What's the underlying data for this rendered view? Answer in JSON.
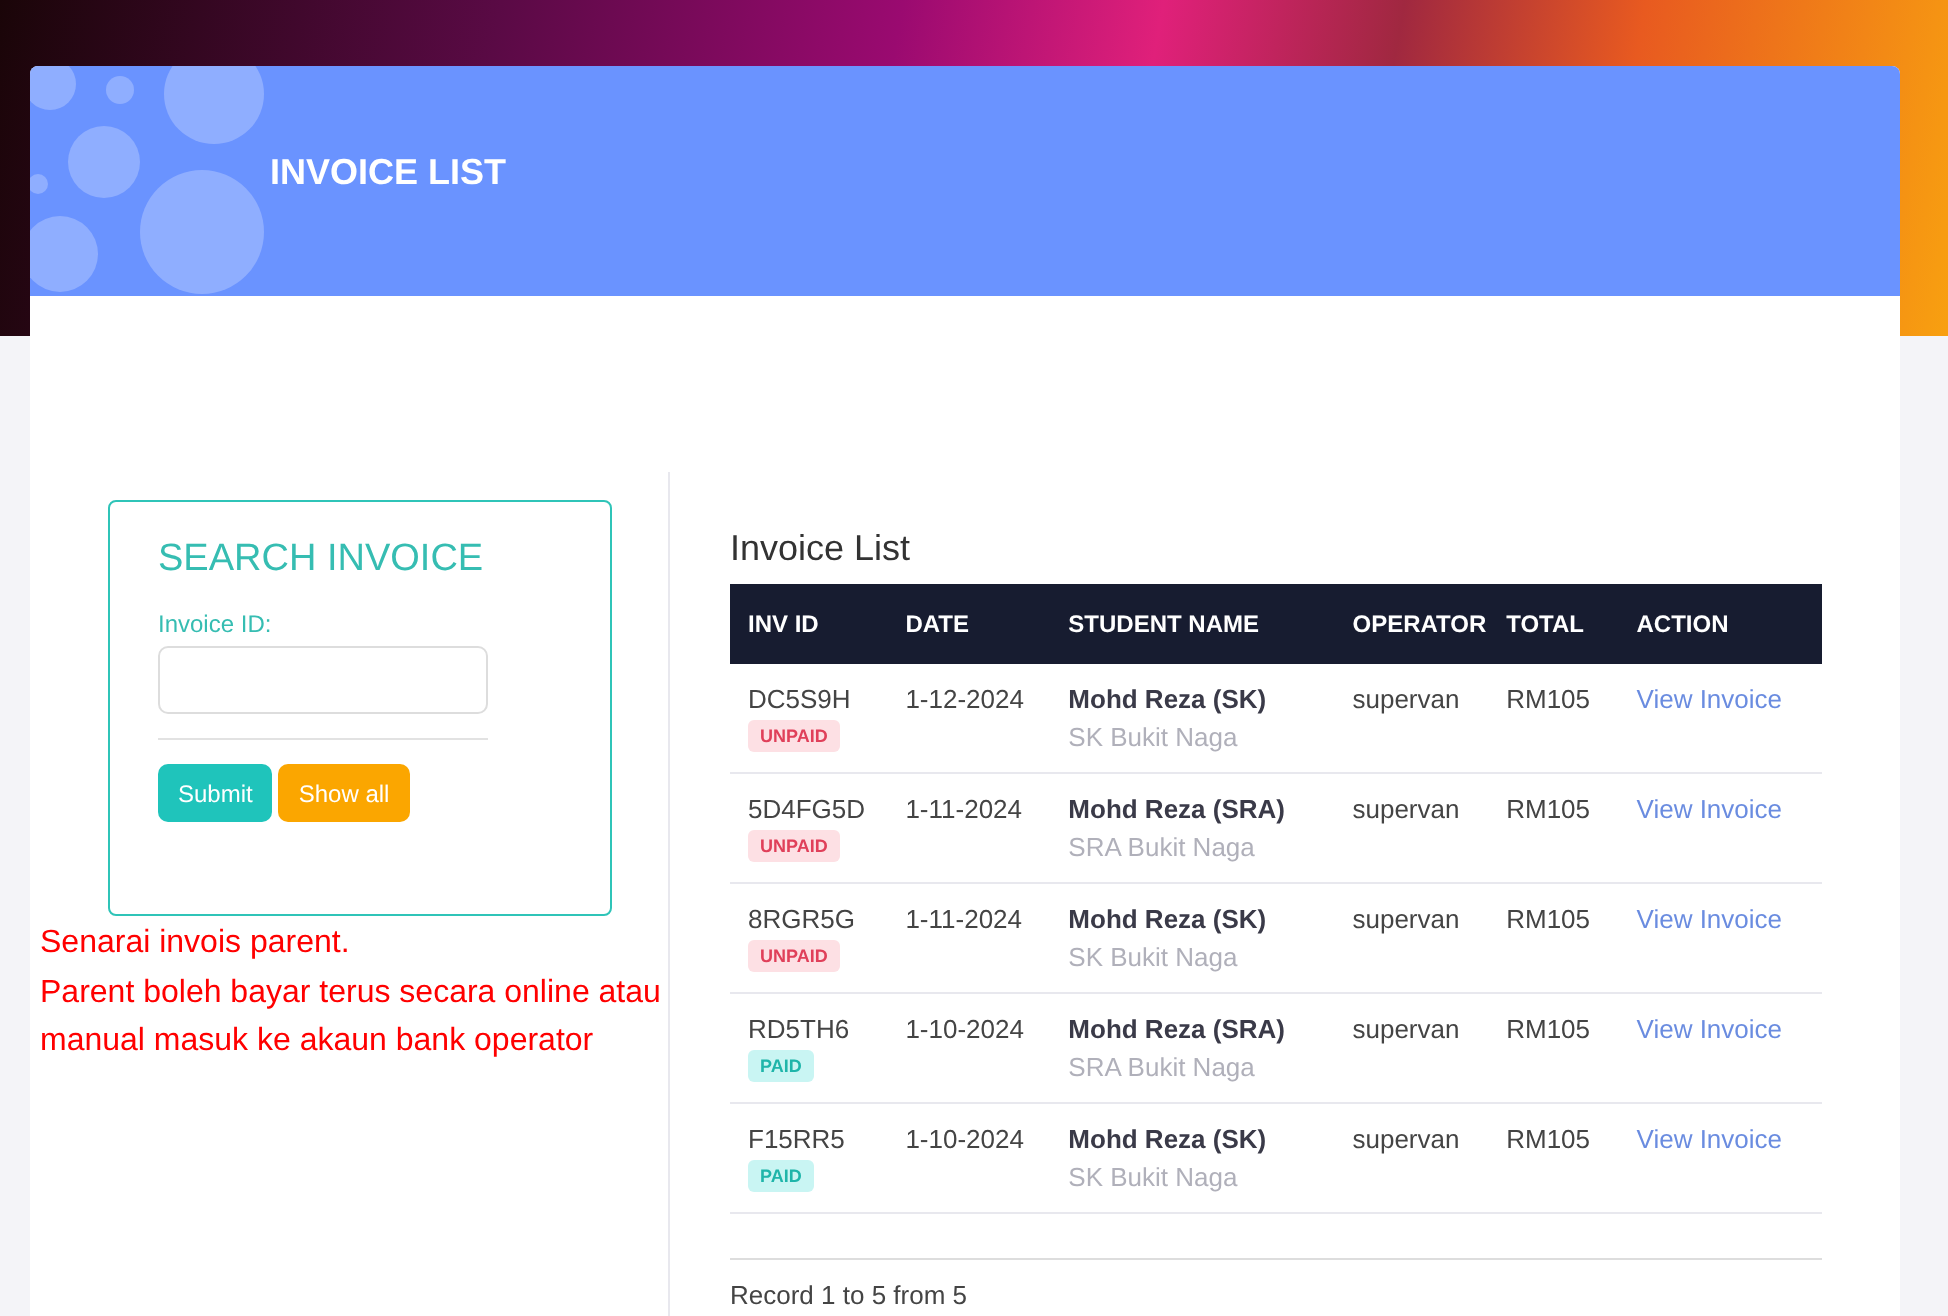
{
  "header": {
    "title": "INVOICE LIST"
  },
  "search": {
    "title": "SEARCH INVOICE",
    "field_label": "Invoice ID:",
    "buttons": [
      {
        "label": "Submit",
        "kind": "primary"
      },
      {
        "label": "Show all",
        "kind": "secondary"
      }
    ]
  },
  "note": [
    "Senarai invois parent.",
    "Parent boleh bayar terus secara online atau",
    "manual masuk ke akaun bank operator"
  ],
  "table": {
    "title": "Invoice List",
    "columns": [
      "INV ID",
      "DATE",
      "STUDENT NAME",
      "OPERATOR",
      "TOTAL",
      "ACTION"
    ],
    "rows": [
      {
        "id": "DC5S9H",
        "status": "UNPAID",
        "paid": false,
        "date": "1-12-2024",
        "student": "Mohd Reza (SK)",
        "school": "SK Bukit Naga",
        "operator": "supervan",
        "total": "RM105",
        "action": "View Invoice"
      },
      {
        "id": "5D4FG5D",
        "status": "UNPAID",
        "paid": false,
        "date": "1-11-2024",
        "student": "Mohd Reza (SRA)",
        "school": "SRA Bukit Naga",
        "operator": "supervan",
        "total": "RM105",
        "action": "View Invoice"
      },
      {
        "id": "8RGR5G",
        "status": "UNPAID",
        "paid": false,
        "date": "1-11-2024",
        "student": "Mohd Reza (SK)",
        "school": "SK Bukit Naga",
        "operator": "supervan",
        "total": "RM105",
        "action": "View Invoice"
      },
      {
        "id": "RD5TH6",
        "status": "PAID",
        "paid": true,
        "date": "1-10-2024",
        "student": "Mohd Reza (SRA)",
        "school": "SRA Bukit Naga",
        "operator": "supervan",
        "total": "RM105",
        "action": "View Invoice"
      },
      {
        "id": "F15RR5",
        "status": "PAID",
        "paid": true,
        "date": "1-10-2024",
        "student": "Mohd Reza (SK)",
        "school": "SK Bukit Naga",
        "operator": "supervan",
        "total": "RM105",
        "action": "View Invoice"
      }
    ],
    "footer": "Record 1 to 5 from 5"
  }
}
